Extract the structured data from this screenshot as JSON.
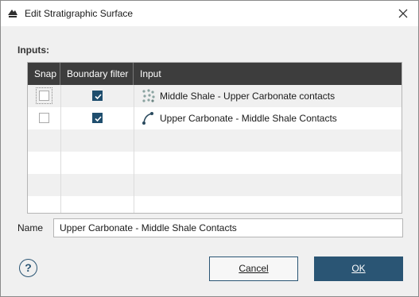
{
  "window": {
    "title": "Edit Stratigraphic Surface"
  },
  "inputs": {
    "label": "Inputs:",
    "columns": [
      "Snap",
      "Boundary filter",
      "Input"
    ],
    "rows": [
      {
        "snap": false,
        "boundary_filter": true,
        "icon": "points-icon",
        "input": "Middle Shale - Upper Carbonate contacts"
      },
      {
        "snap": false,
        "boundary_filter": true,
        "icon": "polyline-icon",
        "input": "Upper Carbonate - Middle Shale Contacts"
      }
    ]
  },
  "name": {
    "label": "Name",
    "value": "Upper Carbonate - Middle Shale Contacts"
  },
  "buttons": {
    "help": "?",
    "cancel": "Cancel",
    "ok": "OK"
  },
  "colors": {
    "header_bg": "#3d3d3d",
    "accent": "#2a5574",
    "checkbox_checked": "#1f4e6e"
  }
}
